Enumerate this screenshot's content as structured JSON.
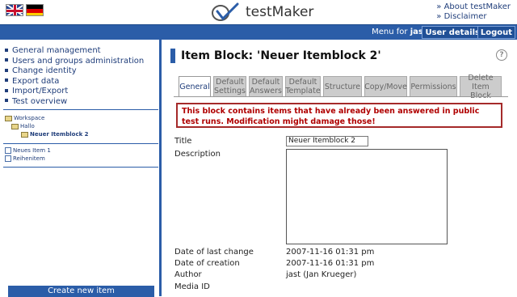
{
  "header": {
    "logo_text": "testMaker",
    "links": [
      "» About testMaker",
      "» Disclaimer"
    ],
    "menu_for_prefix": "Menu for ",
    "username": "jast",
    "menu_for_suffix": ":",
    "user_details": "User details",
    "logout": "Logout"
  },
  "sidebar": {
    "menu": [
      "General management",
      "Users and groups administration",
      "Change identity",
      "Export data",
      "Import/Export",
      "Test overview"
    ],
    "tree": [
      "Workspace",
      "Hallo",
      "Neuer Itemblock 2"
    ],
    "items": [
      "Neues Item 1",
      "Reihenitem"
    ],
    "create_button": "Create new item"
  },
  "main": {
    "title": "Item Block: 'Neuer Itemblock 2'",
    "help": "?",
    "tabs": [
      "General",
      "Default Settings",
      "Default Answers",
      "Default Template",
      "Structure",
      "Copy/Move",
      "Permissions",
      "Delete Item Block"
    ],
    "warning": "This block contains items that have already been answered in public test runs. Modification might damage those!",
    "labels": {
      "title": "Title",
      "description": "Description",
      "last_change": "Date of last change",
      "creation": "Date of creation",
      "author": "Author",
      "media_id": "Media ID"
    },
    "values": {
      "title": "Neuer Itemblock 2",
      "last_change": "2007-11-16 01:31 pm",
      "creation": "2007-11-16 01:31 pm",
      "author": "jast (Jan Krueger)"
    }
  },
  "colors": {
    "accent": "#2b5da8",
    "warning": "#b00000"
  }
}
